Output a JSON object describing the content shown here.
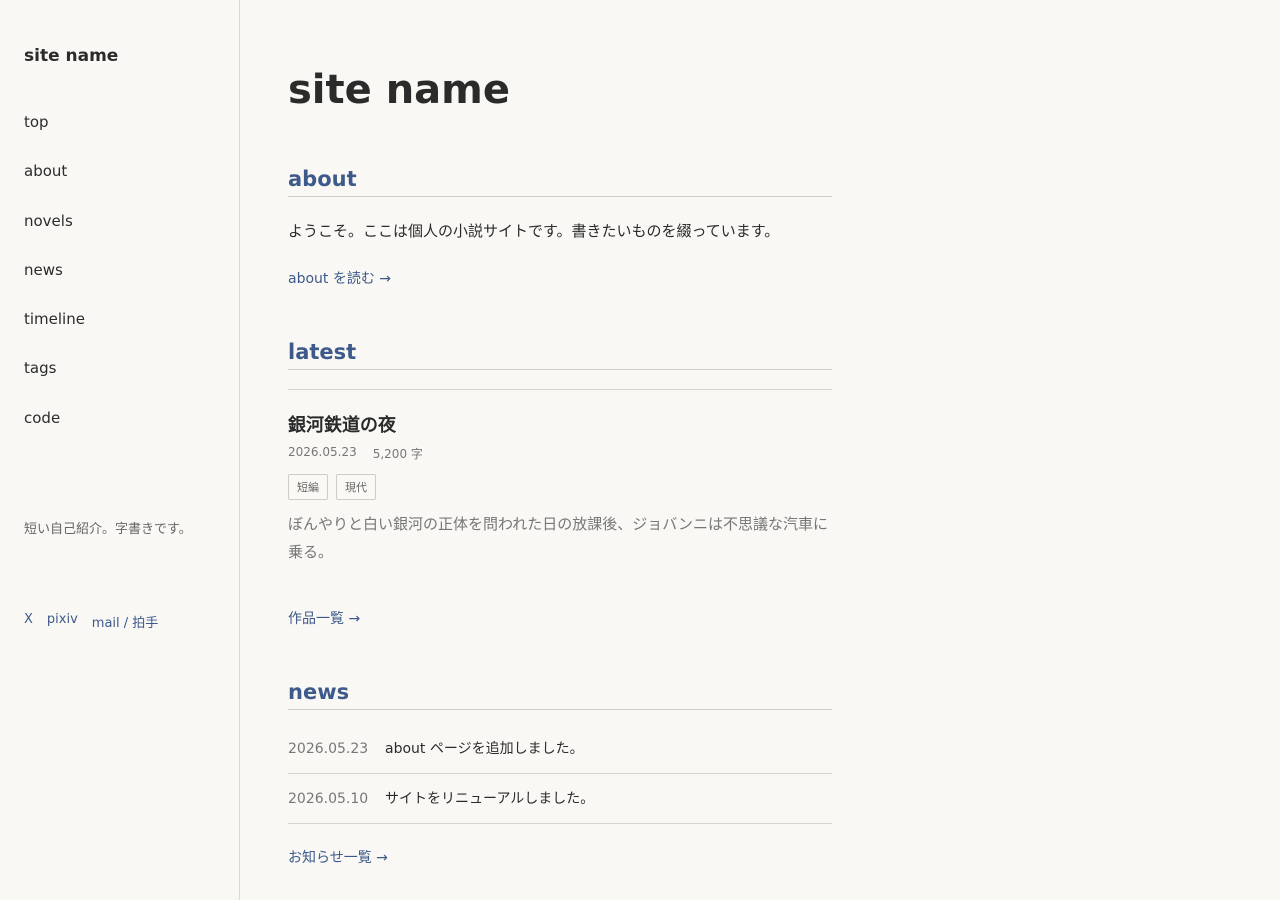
{
  "sidebar": {
    "site_name": "site name",
    "nav": [
      {
        "label": "top"
      },
      {
        "label": "about"
      },
      {
        "label": "novels"
      },
      {
        "label": "news"
      },
      {
        "label": "timeline"
      },
      {
        "label": "tags"
      },
      {
        "label": "code"
      }
    ],
    "intro": "短い自己紹介。字書きです。",
    "links": [
      {
        "label": "X"
      },
      {
        "label": "pixiv"
      },
      {
        "label": "mail / 拍手"
      }
    ]
  },
  "main": {
    "title": "site name",
    "about": {
      "heading": "about",
      "text": "ようこそ。ここは個人の小説サイトです。書きたいものを綴っています。",
      "link": "about を読む →"
    },
    "latest": {
      "heading": "latest",
      "work": {
        "title": "銀河鉄道の夜",
        "date": "2026.05.23",
        "length": "5,200 字",
        "tags": [
          "短編",
          "現代"
        ],
        "excerpt": "ぼんやりと白い銀河の正体を問われた日の放課後、ジョバンニは不思議な汽車に乗る。"
      },
      "link": "作品一覧 →"
    },
    "news": {
      "heading": "news",
      "items": [
        {
          "date": "2026.05.23",
          "text": "about ページを追加しました。"
        },
        {
          "date": "2026.05.10",
          "text": "サイトをリニューアルしました。"
        }
      ],
      "link": "お知らせ一覧 →"
    }
  },
  "colors": {
    "background": "#f9f8f5",
    "accent": "#3e5a8a",
    "text": "#2b2b2b",
    "muted": "#777777"
  }
}
